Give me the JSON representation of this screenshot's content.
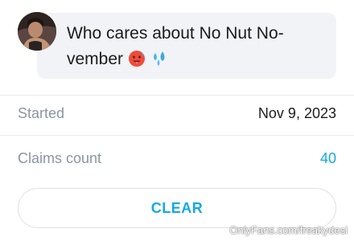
{
  "message": {
    "text": "Who cares about No Nut No-vember",
    "emojis": [
      "hot-face-emoji",
      "sweat-droplets-emoji"
    ]
  },
  "stats": {
    "started_label": "Started",
    "started_value": "Nov 9, 2023",
    "claims_label": "Claims count",
    "claims_value": "40"
  },
  "actions": {
    "clear_label": "CLEAR"
  },
  "watermark": "OnlyFans.com/freakydesi",
  "colors": {
    "accent": "#12a9e6",
    "bubble_bg": "#f1f3f6",
    "label_gray": "#8a96a3",
    "divider": "#e8eaed"
  }
}
